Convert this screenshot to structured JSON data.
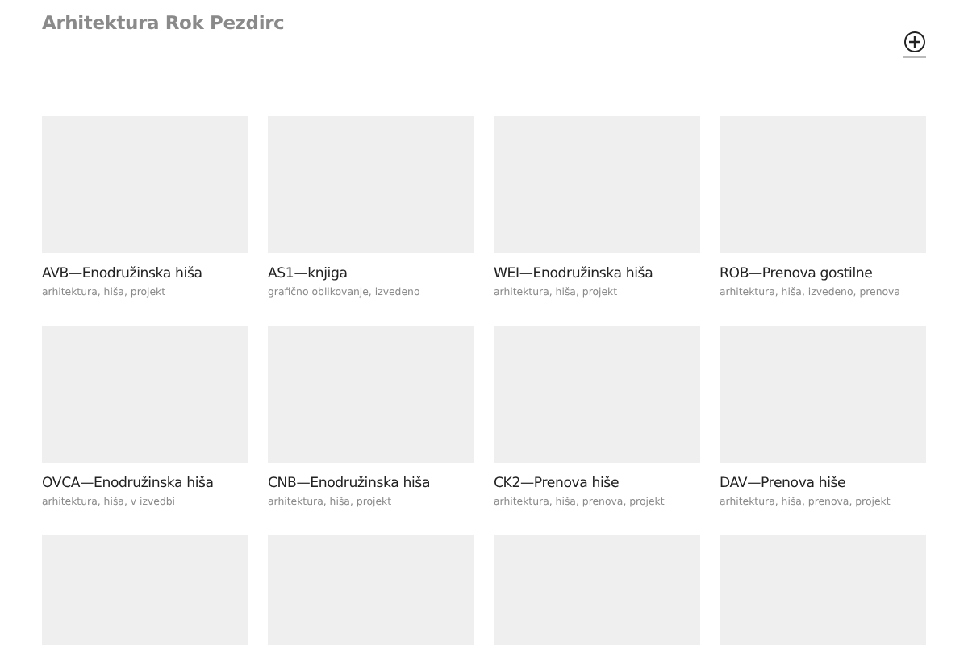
{
  "site_title": "Arhitektura Rok Pezdirc",
  "projects": [
    {
      "kind": "full",
      "title": "AVB—Enodružinska hiša",
      "tags": "arhitektura, hiša, projekt"
    },
    {
      "kind": "full",
      "title": "AS1—knjiga",
      "tags": "grafično oblikovanje, izvedeno"
    },
    {
      "kind": "full",
      "title": "WEI—Enodružinska hiša",
      "tags": "arhitektura, hiša, projekt"
    },
    {
      "kind": "full",
      "title": "ROB—Prenova gostilne",
      "tags": "arhitektura, hiša, izvedeno, prenova"
    },
    {
      "kind": "full",
      "title": "OVCA—Enodružinska hiša",
      "tags": "arhitektura, hiša, v izvedbi"
    },
    {
      "kind": "full",
      "title": "CNB—Enodružinska hiša",
      "tags": "arhitektura, hiša, projekt"
    },
    {
      "kind": "full",
      "title": "CK2—Prenova hiše",
      "tags": "arhitektura, hiša, prenova, projekt"
    },
    {
      "kind": "full",
      "title": "DAV—Prenova hiše",
      "tags": "arhitektura, hiša, prenova, projekt"
    },
    {
      "kind": "image_only"
    },
    {
      "kind": "image_only"
    },
    {
      "kind": "image_only"
    },
    {
      "kind": "image_only"
    }
  ]
}
